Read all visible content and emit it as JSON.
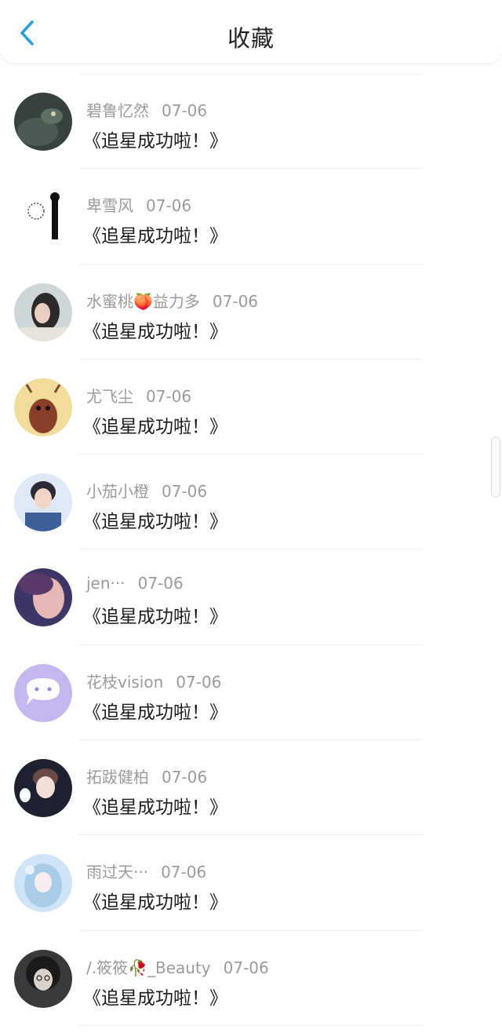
{
  "header": {
    "title": "收藏",
    "back_icon": "chevron-left-icon",
    "accent": "#2a9fd8"
  },
  "items": [
    {
      "name": "碧鲁忆然",
      "date": "07-06",
      "message": "《追星成功啦！》"
    },
    {
      "name": "卑雪风",
      "date": "07-06",
      "message": "《追星成功啦！》"
    },
    {
      "name": "水蜜桃🍑益力多",
      "date": "07-06",
      "message": "《追星成功啦！》"
    },
    {
      "name": "尤飞尘",
      "date": "07-06",
      "message": "《追星成功啦！》"
    },
    {
      "name": "小茄小橙",
      "date": "07-06",
      "message": "《追星成功啦！》"
    },
    {
      "name": "jen···",
      "date": "07-06",
      "message": "《追星成功啦！》"
    },
    {
      "name": "花枝vision",
      "date": "07-06",
      "message": "《追星成功啦！》"
    },
    {
      "name": "拓跋健柏",
      "date": "07-06",
      "message": "《追星成功啦！》"
    },
    {
      "name": "雨过天···",
      "date": "07-06",
      "message": "《追星成功啦！》"
    },
    {
      "name": "/.筱筱🥀_Beauty",
      "date": "07-06",
      "message": "《追星成功啦！》"
    }
  ]
}
